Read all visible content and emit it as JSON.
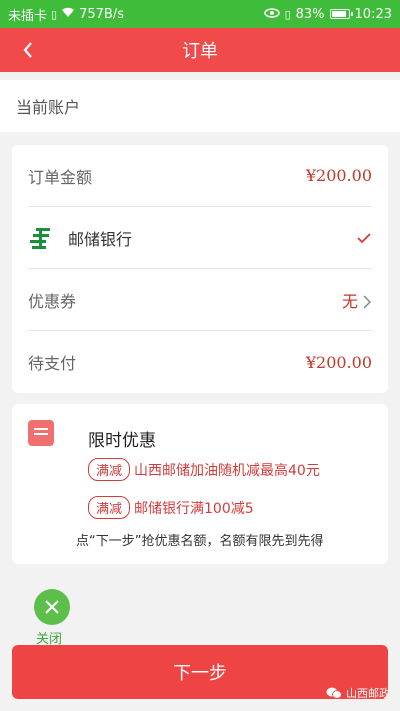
{
  "status_bar": {
    "carrier": "未插卡",
    "speed": "757B/s",
    "battery": "83%",
    "time": "10:23"
  },
  "nav": {
    "title": "订单"
  },
  "account": {
    "label": "当前账户"
  },
  "order": {
    "amount_label": "订单金额",
    "amount_value": "¥200.00",
    "bank_name": "邮储银行",
    "coupon_label": "优惠券",
    "coupon_value": "无",
    "pay_label": "待支付",
    "pay_value": "¥200.00"
  },
  "promo": {
    "title": "限时优惠",
    "items": [
      {
        "tag": "满减",
        "text": "山西邮储加油随机减最高40元"
      },
      {
        "tag": "满减",
        "text": "邮储银行满100减5"
      }
    ],
    "note": "点“下一步”抢优惠名额，名额有限先到先得"
  },
  "close": {
    "label": "关闭"
  },
  "next_button": {
    "label": "下一步"
  },
  "watermark": {
    "text": "山西邮政"
  },
  "colors": {
    "status_bar": "#3ebc3a",
    "nav_bar": "#f04a4a",
    "price": "#c0392b",
    "button": "#ef4444",
    "close": "#5bbf4a"
  }
}
